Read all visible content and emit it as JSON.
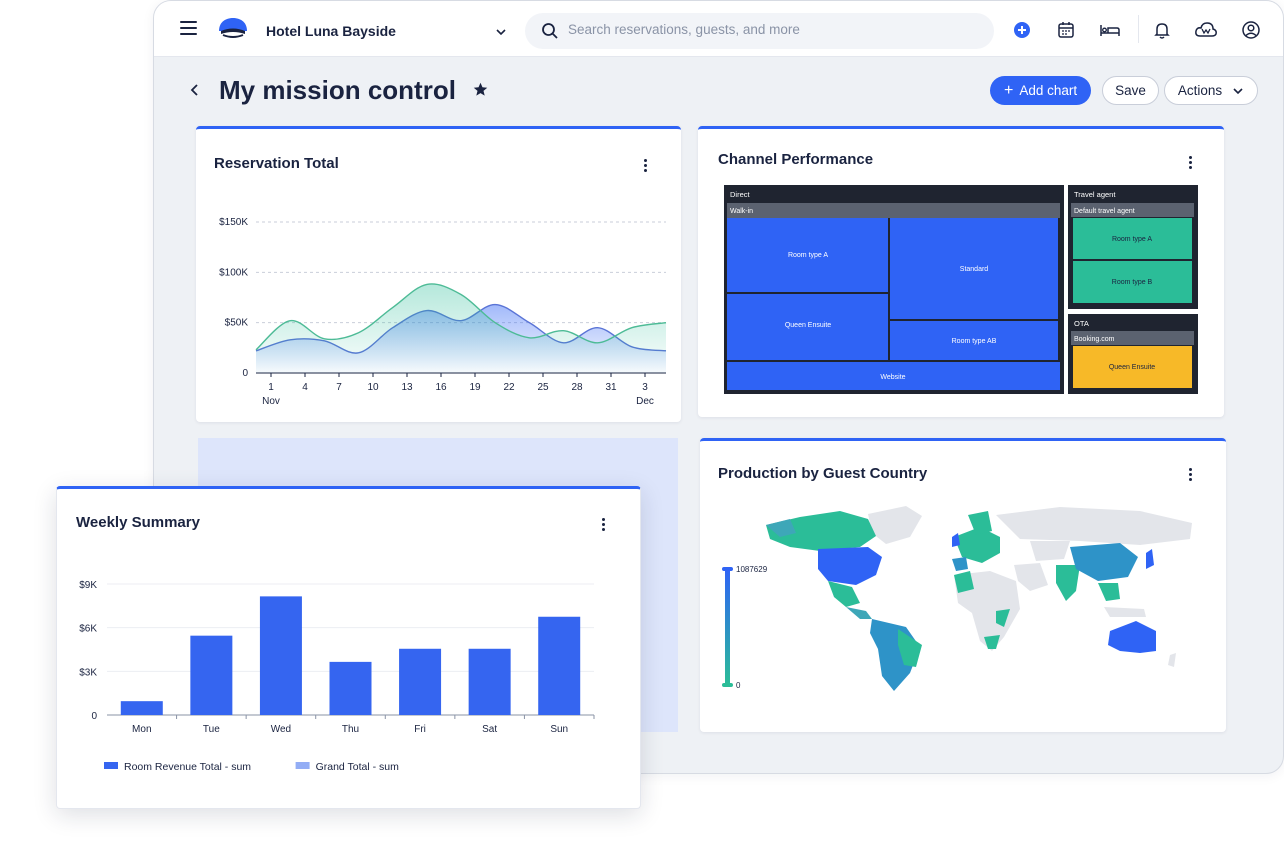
{
  "header": {
    "hotel_name": "Hotel Luna Bayside",
    "search_placeholder": "Search reservations, guests, and more"
  },
  "page": {
    "title": "My mission control",
    "add_chart_label": "Add chart",
    "save_label": "Save",
    "actions_label": "Actions"
  },
  "colors": {
    "accent": "#2f63f5",
    "teal": "#2bbd98",
    "yellow": "#f7b928",
    "dark": "#1f2430"
  },
  "reservation_total": {
    "title": "Reservation Total",
    "chart_data": {
      "type": "area",
      "x": [
        "1",
        "4",
        "7",
        "10",
        "13",
        "16",
        "19",
        "22",
        "25",
        "28",
        "31",
        "3"
      ],
      "x_month_labels": [
        "Nov",
        "Dec"
      ],
      "y_ticks": [
        "$150K",
        "$100K",
        "$50K",
        "0"
      ],
      "ylim": [
        0,
        150000
      ],
      "series": [
        {
          "values": [
            22000,
            33000,
            32000,
            20000,
            45000,
            62000,
            52000,
            68000,
            50000,
            30000,
            45000,
            26000,
            22000
          ]
        },
        {
          "values": [
            23000,
            52000,
            34000,
            40000,
            65000,
            88000,
            78000,
            50000,
            35000,
            42000,
            30000,
            45000,
            50000
          ]
        }
      ],
      "grid": true
    }
  },
  "channel_performance": {
    "title": "Channel Performance",
    "chart_data": {
      "type": "treemap",
      "groups": [
        {
          "name": "Direct",
          "subgroups": [
            {
              "name": "Walk-in",
              "items": [
                "Room type A",
                "Standard",
                "Queen Ensuite",
                "Room type AB"
              ]
            },
            {
              "name": "Website",
              "items": []
            }
          ]
        },
        {
          "name": "Travel agent",
          "subgroups": [
            {
              "name": "Default travel agent",
              "items": [
                "Room type A",
                "Room type B"
              ]
            }
          ]
        },
        {
          "name": "OTA",
          "subgroups": [
            {
              "name": "Booking.com",
              "items": [
                "Queen Ensuite"
              ]
            }
          ]
        }
      ]
    }
  },
  "production_by_country": {
    "title": "Production by Guest Country",
    "chart_data": {
      "type": "choropleth",
      "scale_max": "1087629",
      "scale_min": "0"
    }
  },
  "weekly_summary": {
    "title": "Weekly Summary",
    "chart_data": {
      "type": "bar",
      "categories": [
        "Mon",
        "Tue",
        "Wed",
        "Thu",
        "Fri",
        "Sat",
        "Sun"
      ],
      "series": [
        {
          "name": "Room Revenue Total - sum",
          "values": [
            950,
            5450,
            8150,
            3650,
            4550,
            4550,
            6750
          ]
        },
        {
          "name": "Grand Total - sum",
          "values": []
        }
      ],
      "y_ticks": [
        "$9K",
        "$6K",
        "$3K",
        "0"
      ],
      "ylim": [
        0,
        9000
      ],
      "legend": "bottom-left"
    }
  }
}
